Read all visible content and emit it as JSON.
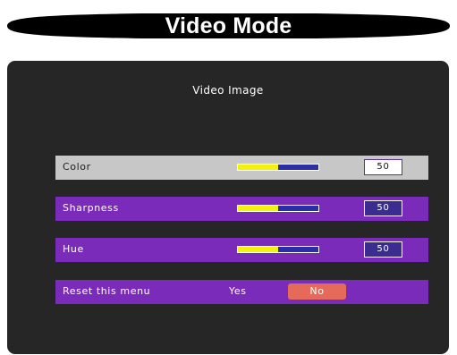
{
  "banner": {
    "title": "Video Mode"
  },
  "panel": {
    "title": "Video Image"
  },
  "rows": [
    {
      "label": "Color",
      "value": "50",
      "level": 0.5,
      "selected": true
    },
    {
      "label": "Sharpness",
      "value": "50",
      "level": 0.5,
      "selected": false
    },
    {
      "label": "Hue",
      "value": "50",
      "level": 0.5,
      "selected": false
    }
  ],
  "reset": {
    "label": "Reset this menu",
    "yes": "Yes",
    "no": "No",
    "selected_option": "No"
  },
  "colors": {
    "banner": "#000000",
    "panel": "#262626",
    "row": "#7b2bb9",
    "row_selected": "#c7c7c7",
    "slider_fill": "#f2f20a",
    "slider_track": "#2a2fa6",
    "option_highlight": "#e56a5a"
  }
}
